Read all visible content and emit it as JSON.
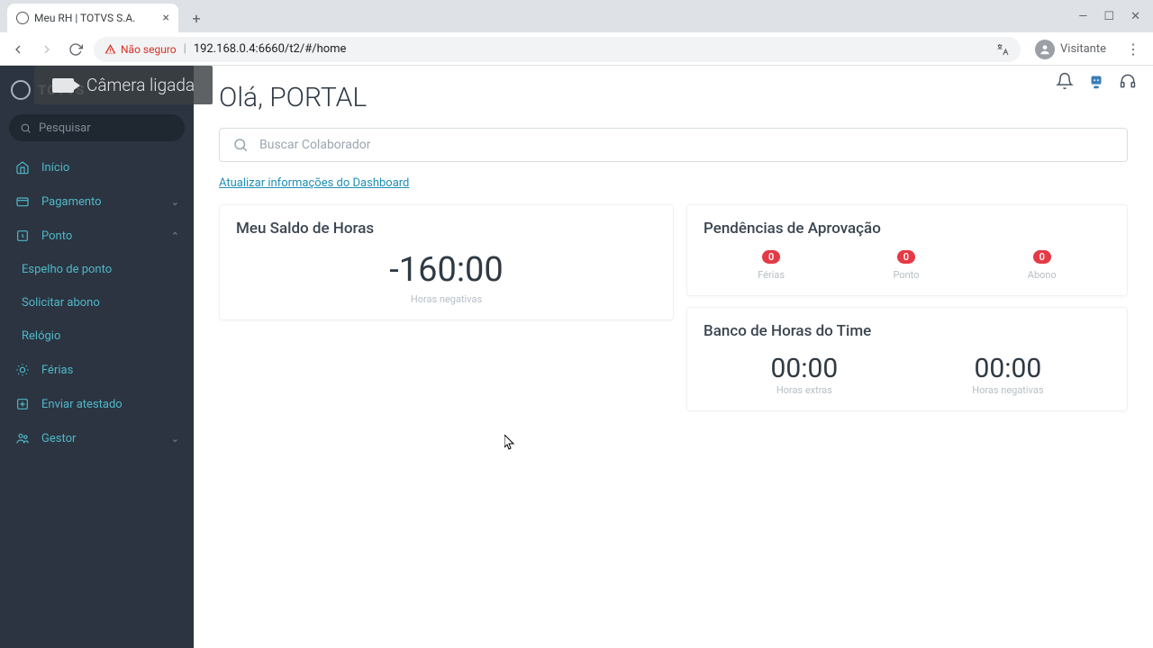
{
  "browser": {
    "tab_title": "Meu RH | TOTVS S.A.",
    "insecure_label": "Não seguro",
    "url": "192.168.0.4:6660/t2/#/home",
    "visitor_label": "Visitante"
  },
  "overlay": {
    "camera": "Câmera ligada"
  },
  "sidebar": {
    "brand": "TOTVS",
    "search_placeholder": "Pesquisar",
    "items": {
      "inicio": "Início",
      "pagamento": "Pagamento",
      "ponto": "Ponto",
      "espelho": "Espelho de ponto",
      "abono": "Solicitar abono",
      "relogio": "Relógio",
      "ferias": "Férias",
      "atestado": "Enviar atestado",
      "gestor": "Gestor"
    }
  },
  "main": {
    "greeting": "Olá, PORTAL",
    "search_placeholder": "Buscar Colaborador",
    "update_link": "Atualizar informações do Dashboard",
    "saldo": {
      "title": "Meu Saldo de Horas",
      "value": "-160:00",
      "label": "Horas negativas"
    },
    "pendencias": {
      "title": "Pendências de Aprovação",
      "ferias": {
        "count": "0",
        "label": "Férias"
      },
      "ponto": {
        "count": "0",
        "label": "Ponto"
      },
      "abono": {
        "count": "0",
        "label": "Abono"
      }
    },
    "banco": {
      "title": "Banco de Horas do Time",
      "extras": {
        "value": "00:00",
        "label": "Horas extras"
      },
      "negativas": {
        "value": "00:00",
        "label": "Horas negativas"
      }
    }
  }
}
